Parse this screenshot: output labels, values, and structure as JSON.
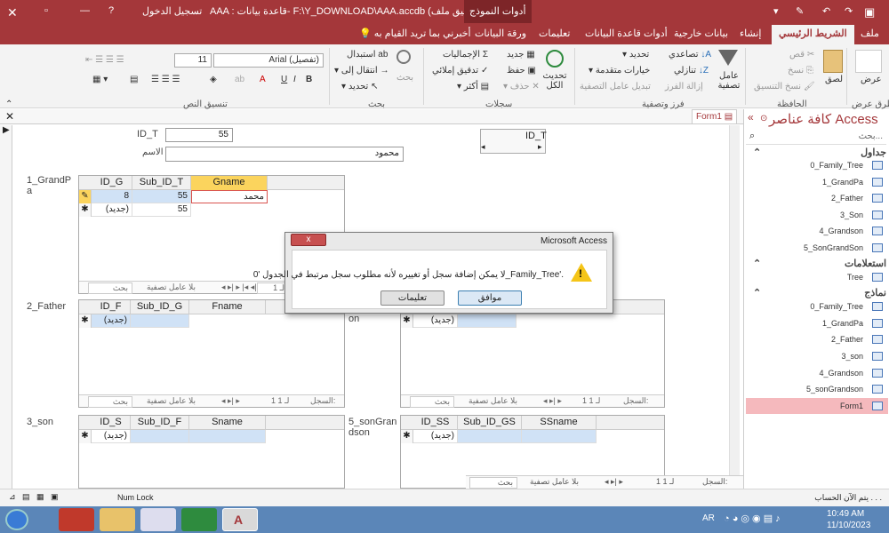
{
  "titlebar": {
    "tools_tab": "أدوات النموذج",
    "title": "AAA : قاعدة بيانات- F:\\Y_DOWNLOAD\\AAA.accdb (تنسيق ملف A...",
    "signin": "تسجيل الدخول",
    "help": "?"
  },
  "tabs": {
    "file": "ملف",
    "home": "الشريط الرئيسي",
    "create": "إنشاء",
    "external": "بيانات خارجية",
    "dbtools": "أدوات قاعدة البيانات",
    "help": "تعليمات",
    "datasheet": "ورقة البيانات",
    "tellme": "أخبرني بما تريد القيام به"
  },
  "ribbon": {
    "views": {
      "view": "عرض",
      "group": "طرق عرض"
    },
    "clipboard": {
      "paste": "لصق",
      "cut": "قص",
      "copy": "نسخ",
      "format_painter": "نسخ التنسيق",
      "group": "الحافظة"
    },
    "sort": {
      "filter": "عامل تصفية",
      "ascending": "تصاعدي",
      "descending": "تنازلي",
      "remove_sort": "إزالة الفرز",
      "selection": "تحديد",
      "advanced": "خيارات متقدمة",
      "toggle_filter": "تبديل عامل التصفية",
      "group": "فرز وتصفية"
    },
    "records": {
      "refresh": "تحديث الكل",
      "new": "جديد",
      "save": "حفظ",
      "delete": "حذف",
      "totals": "الإجماليات",
      "spelling": "تدقيق إملائي",
      "more": "أكثر",
      "group": "سجلات"
    },
    "find": {
      "find": "بحث",
      "replace": "استبدال",
      "goto": "انتقال إلى",
      "select": "تحديد",
      "group": "بحث"
    },
    "text": {
      "font": "Arial (تفصيل)",
      "size": "11",
      "group": "تنسيق النص"
    }
  },
  "nav": {
    "title": "كافة عناصر Access",
    "search_placeholder": "بحث...",
    "tables_label": "جداول",
    "queries_label": "استعلامات",
    "forms_label": "نماذج",
    "tables": [
      "0_Family_Tree",
      "1_GrandPa",
      "2_Father",
      "3_Son",
      "4_Grandson",
      "5_SonGrandSon"
    ],
    "queries": [
      "Tree"
    ],
    "forms": [
      "0_Family_Tree",
      "1_GrandPa",
      "2_Father",
      "3_son",
      "4_Grandson",
      "5_sonGrandson",
      "Form1"
    ]
  },
  "form": {
    "tab": "Form1",
    "id_label": "ID_T",
    "id_value": "55",
    "name_label": "الاسم",
    "name_value": "محمود",
    "combo_label": "ID_T",
    "grandpa": {
      "label": "1_GrandPa",
      "cols": [
        "ID_G",
        "Sub_ID_T",
        "Gname"
      ],
      "row1": [
        "8",
        "55",
        "محمد"
      ],
      "new_label": "(جديد)",
      "new_sub": "55"
    },
    "father": {
      "label": "2_Father",
      "cols": [
        "ID_F",
        "Sub_ID_G",
        "Fname"
      ],
      "new_label": "(جديد)"
    },
    "son": {
      "label": "3_son",
      "cols": [
        "ID_S",
        "Sub_ID_F",
        "Sname"
      ],
      "new_label": "(جديد)"
    },
    "grandson": {
      "label": "on",
      "new_label": "(جديد)"
    },
    "songrandson": {
      "label": "5_sonGrandson",
      "cols": [
        "ID_SS",
        "Sub_ID_GS",
        "SSname"
      ],
      "new_label": "(جديد)"
    },
    "nav": {
      "record": "السجل:",
      "pos": "1 لـ 1",
      "nofilter": "بلا عامل تصفية",
      "search": "بحث",
      "pos_short": "1 لـ"
    }
  },
  "dialog": {
    "title": "Microsoft Access",
    "message": "لا يمكن إضافة سجل أو تغييره لأنه مطلوب سجل مرتبط في الجدول '0_Family_Tree'.",
    "ok": "موافق",
    "help": "تعليمات",
    "close": "x"
  },
  "status": {
    "numlock": "Num Lock",
    "calc": "يتم الآن الحساب . . ."
  },
  "taskbar": {
    "lang": "AR",
    "time": "10:49 AM",
    "date": "11/10/2023"
  }
}
